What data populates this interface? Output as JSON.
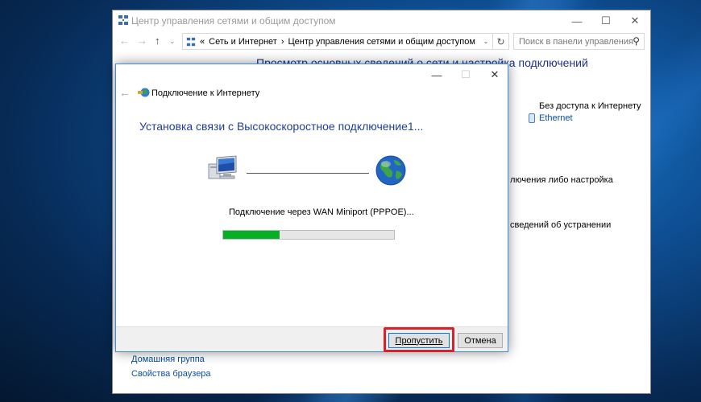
{
  "control_panel": {
    "title": "Центр управления сетями и общим доступом",
    "window_controls": {
      "minimize": "—",
      "maximize": "☐",
      "close": "✕"
    },
    "nav": {
      "back": "←",
      "forward": "→",
      "up": "↑",
      "refresh": "↻"
    },
    "address": {
      "prefix": "«",
      "crumb1": "Сеть и Интернет",
      "separator": "›",
      "crumb2": "Центр управления сетями и общим доступом",
      "dropdown": "⌄"
    },
    "search": {
      "placeholder": "Поиск в панели управления",
      "icon": "search-icon"
    },
    "heading": "Просмотр основных сведений о сети и настройка подключений",
    "access_type": "Без доступа к Интернету",
    "connection_link": "Ethernet",
    "partial_text_1": "лючения либо настройка",
    "partial_text_2": "сведений об устранении",
    "see_also_1": "Домашняя группа",
    "see_also_2": "Свойства браузера"
  },
  "dialog": {
    "title": "Подключение к Интернету",
    "back": "←",
    "window_controls": {
      "minimize": "—",
      "maximize": "☐",
      "close": "✕"
    },
    "heading": "Установка связи с Высокоскоростное подключение1...",
    "status": "Подключение через WAN Miniport (PPPOE)...",
    "progress_fraction": 0.33,
    "skip_button": "Пропустить",
    "cancel_button": "Отмена"
  },
  "colors": {
    "highlight": "#d8212a",
    "progress": "#06b025",
    "heading": "#1e3f9a",
    "link": "#0b4ea2"
  }
}
